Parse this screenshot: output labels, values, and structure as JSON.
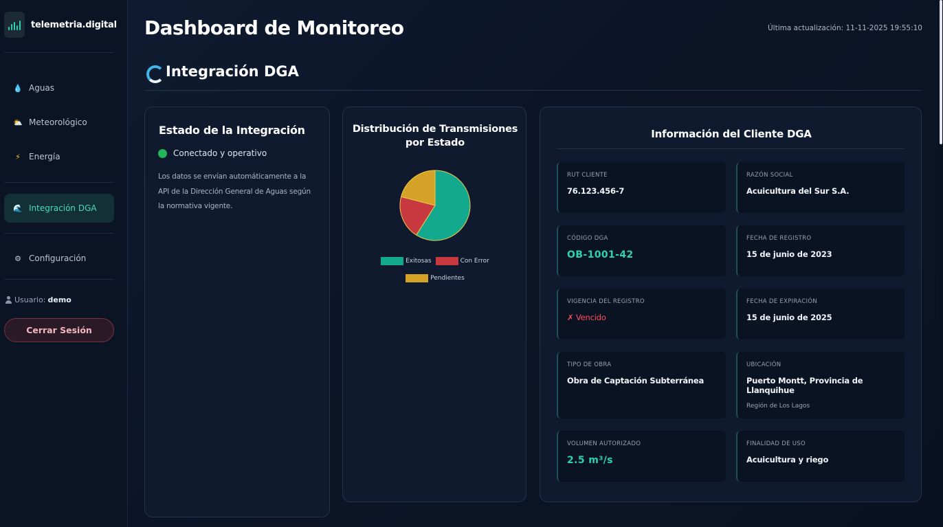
{
  "sidebar": {
    "brand": "telemetria.digital",
    "items": [
      {
        "label": "Aguas",
        "icon": "droplet-icon"
      },
      {
        "label": "Meteorológico",
        "icon": "sun-cloud-icon"
      },
      {
        "label": "Energía",
        "icon": "lightning-icon"
      },
      {
        "label": "Integración DGA",
        "icon": "wave-icon",
        "active": true
      },
      {
        "label": "Configuración",
        "icon": "gear-icon"
      }
    ],
    "user_label": "Usuario:",
    "user_name": "demo",
    "logout_label": "Cerrar Sesión"
  },
  "header": {
    "title": "Dashboard de Monitoreo",
    "last_update": "Última actualización: 11-11-2025 19:55:10"
  },
  "section": {
    "title": "Integración DGA"
  },
  "status_card": {
    "title": "Estado de la Integración",
    "status_text": "Conectado y operativo",
    "status_color": "#22b55a",
    "description": "Los datos se envían automáticamente a la API de la Dirección General de Aguas según la normativa vigente."
  },
  "chart_card": {
    "title_line1": "Distribución de Transmisiones",
    "title_line2": "por Estado"
  },
  "chart_data": {
    "type": "pie",
    "title": "Distribución de Transmisiones por Estado",
    "categories": [
      "Exitosas",
      "Con Error",
      "Pendientes"
    ],
    "values": [
      59,
      20,
      21
    ],
    "colors": [
      "#13a98f",
      "#c8383f",
      "#d4a227"
    ],
    "legend": "bottom"
  },
  "client_card": {
    "title": "Información del Cliente DGA",
    "fields": [
      {
        "label": "RUT CLIENTE",
        "value": "76.123.456-7"
      },
      {
        "label": "RAZÓN SOCIAL",
        "value": "Acuicultura del Sur S.A."
      },
      {
        "label": "CÓDIGO DGA",
        "value": "OB-1001-42"
      },
      {
        "label": "FECHA DE REGISTRO",
        "value": "15 de junio de 2023"
      },
      {
        "label": "VIGENCIA DEL REGISTRO",
        "value": "✗ Vencido"
      },
      {
        "label": "FECHA DE EXPIRACIÓN",
        "value": "15 de junio de 2025"
      },
      {
        "label": "TIPO DE OBRA",
        "value": "Obra de Captación Subterránea"
      },
      {
        "label": "UBICACIÓN",
        "value": "Puerto Montt, Provincia de Llanquihue",
        "sub": "Región de Los Lagos"
      },
      {
        "label": "VOLUMEN AUTORIZADO",
        "value": "2.5 m³/s"
      },
      {
        "label": "FINALIDAD DE USO",
        "value": "Acuicultura y riego"
      }
    ]
  },
  "colors": {
    "accent": "#2bd3b1",
    "danger": "#ff4d5e",
    "background": "#0d1526"
  }
}
